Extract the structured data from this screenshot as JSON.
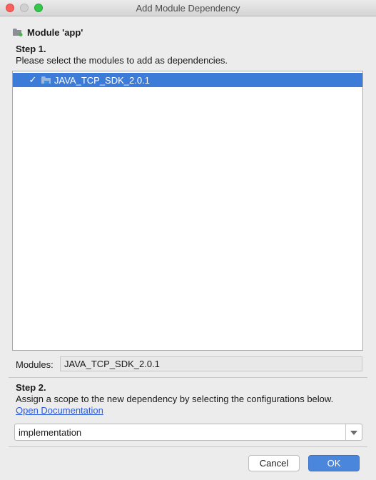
{
  "window": {
    "title": "Add Module Dependency"
  },
  "module": {
    "label": "Module 'app'",
    "icon": "module-folder-icon"
  },
  "step1": {
    "title": "Step 1.",
    "description": "Please select the modules to add as dependencies.",
    "items": [
      {
        "label": "JAVA_TCP_SDK_2.0.1",
        "checked": true,
        "check_glyph": "✓",
        "selected": true
      }
    ]
  },
  "modules": {
    "label": "Modules:",
    "value": "JAVA_TCP_SDK_2.0.1"
  },
  "step2": {
    "title": "Step 2.",
    "description": "Assign a scope to the new dependency by selecting the configurations below.",
    "link": "Open Documentation",
    "scope_value": "implementation"
  },
  "buttons": {
    "cancel": "Cancel",
    "ok": "OK"
  },
  "colors": {
    "selection": "#3d7bd8",
    "ok_button": "#4a86dc",
    "link": "#2a5bdc"
  }
}
